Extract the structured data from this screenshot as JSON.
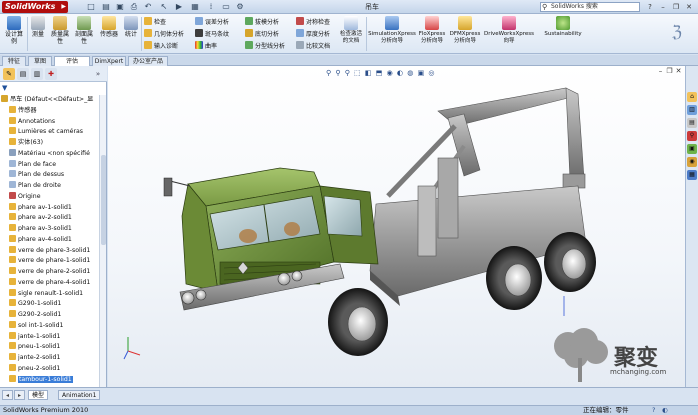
{
  "app": {
    "logo": "SolidWorks",
    "document_title": "吊车",
    "search_placeholder": "SolidWorks 搜索"
  },
  "ribbon": {
    "big_buttons": [
      {
        "label": "设计算例",
        "icon": "design-study-icon"
      },
      {
        "label": "测量",
        "icon": "measure-icon"
      },
      {
        "label": "质量属性",
        "icon": "mass-properties-icon"
      },
      {
        "label": "剖面属性",
        "icon": "section-properties-icon"
      },
      {
        "label": "传感器",
        "icon": "sensor-icon"
      },
      {
        "label": "统计",
        "icon": "statistics-icon"
      }
    ],
    "col1": [
      "检查",
      "几何体分析",
      "输入诊断"
    ],
    "col2": [
      "误差分析",
      "斑马条纹",
      "曲率"
    ],
    "col3": [
      "拔模分析",
      "底切分析",
      "分型线分析"
    ],
    "col4": [
      "对称检查",
      "厚度分析",
      "比较文档"
    ],
    "check_active_doc": "检查激活的文档",
    "addins": [
      {
        "label": "SimulationXpress 分析向导"
      },
      {
        "label": "FloXpress 分析向导"
      },
      {
        "label": "DFMXpress 分析向导"
      },
      {
        "label": "DriveWorksXpress 向导"
      },
      {
        "label": "Sustainability"
      }
    ]
  },
  "tabs": [
    "特征",
    "草图",
    "评估",
    "DimXpert",
    "办公室产品"
  ],
  "active_tab_index": 2,
  "tree": {
    "root": "吊车 (Défaut<<Défaut>_显",
    "items": [
      {
        "label": "传感器",
        "icon": "sensor-folder-icon",
        "indent": 1
      },
      {
        "label": "Annotations",
        "icon": "annotations-icon",
        "indent": 1
      },
      {
        "label": "Lumières et caméras",
        "icon": "lights-cameras-icon",
        "indent": 1
      },
      {
        "label": "实体(63)",
        "icon": "solid-bodies-icon",
        "indent": 1
      },
      {
        "label": "Matériau <non spécifié",
        "icon": "material-icon",
        "indent": 1
      },
      {
        "label": "Plan de face",
        "icon": "plane-icon",
        "indent": 1
      },
      {
        "label": "Plan de dessus",
        "icon": "plane-icon",
        "indent": 1
      },
      {
        "label": "Plan de droite",
        "icon": "plane-icon",
        "indent": 1
      },
      {
        "label": "Origine",
        "icon": "origin-icon",
        "indent": 1
      },
      {
        "label": "phare av-1-solid1",
        "icon": "feature-icon",
        "indent": 1
      },
      {
        "label": "phare av-2-solid1",
        "icon": "feature-icon",
        "indent": 1
      },
      {
        "label": "phare av-3-solid1",
        "icon": "feature-icon",
        "indent": 1
      },
      {
        "label": "phare av-4-solid1",
        "icon": "feature-icon",
        "indent": 1
      },
      {
        "label": "verre de phare-3-solid1",
        "icon": "feature-icon",
        "indent": 1
      },
      {
        "label": "verre de phare-1-solid1",
        "icon": "feature-icon",
        "indent": 1
      },
      {
        "label": "verre de phare-2-solid1",
        "icon": "feature-icon",
        "indent": 1
      },
      {
        "label": "verre de phare-4-solid1",
        "icon": "feature-icon",
        "indent": 1
      },
      {
        "label": "sigle renault-1-solid1",
        "icon": "feature-icon",
        "indent": 1
      },
      {
        "label": "G290-1-solid1",
        "icon": "feature-icon",
        "indent": 1
      },
      {
        "label": "G290-2-solid1",
        "icon": "feature-icon",
        "indent": 1
      },
      {
        "label": "sol int-1-solid1",
        "icon": "feature-icon",
        "indent": 1
      },
      {
        "label": "jante-1-solid1",
        "icon": "feature-icon",
        "indent": 1
      },
      {
        "label": "pneu-1-solid1",
        "icon": "feature-icon",
        "indent": 1
      },
      {
        "label": "jante-2-solid1",
        "icon": "feature-icon",
        "indent": 1
      },
      {
        "label": "pneu-2-solid1",
        "icon": "feature-icon",
        "indent": 1
      },
      {
        "label": "tambour-1-solid1",
        "icon": "feature-icon",
        "indent": 1,
        "selected": true
      }
    ]
  },
  "bottom_tabs": [
    "模型",
    "Animation1"
  ],
  "status": {
    "left": "SolidWorks Premium 2010",
    "right": "正在编辑：零件"
  },
  "watermark": {
    "name": "聚变",
    "url": "mchanging.com"
  },
  "colors": {
    "accent": "#3a7dd8",
    "logo_red": "#b00d0d",
    "truck_cab": "#6e8f3e",
    "truck_body": "#8a8a8a"
  }
}
